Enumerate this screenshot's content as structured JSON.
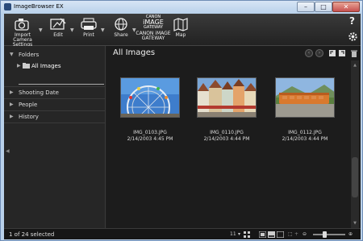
{
  "window": {
    "title": "ImageBrowser EX",
    "min_glyph": "–",
    "max_glyph": "□",
    "close_glyph": "✕"
  },
  "toolbar": {
    "import_label_1": "Import",
    "import_label_2": "Camera Settings",
    "edit_label": "Edit",
    "print_label": "Print",
    "share_label": "Share",
    "gateway_logo_1": "CANON",
    "gateway_logo_2": "iMAGE",
    "gateway_logo_3": "GATEWAY",
    "gateway_label_1": "CANON iMAGE",
    "gateway_label_2": "GATEWAY",
    "map_label": "Map",
    "help_glyph": "?"
  },
  "sidebar": {
    "folders_label": "Folders",
    "all_images_label": "All Images",
    "shooting_date_label": "Shooting Date",
    "people_label": "People",
    "history_label": "History"
  },
  "main": {
    "title": "All Images",
    "items": [
      {
        "filename": "IMG_0103.JPG",
        "date": "2/14/2003 4:45 PM"
      },
      {
        "filename": "IMG_0110.JPG",
        "date": "2/14/2003 4:44 PM"
      },
      {
        "filename": "IMG_0112.JPG",
        "date": "2/14/2003 4:44 PM"
      }
    ]
  },
  "status": {
    "selection_text": "1 of 24 selected",
    "view_size": "11",
    "zoom_fraction": 0.35
  },
  "colors": {
    "app_bg": "#1f1f1f",
    "panel_bg": "#262626",
    "titlebar": "#b9d1ea",
    "close_red": "#c75050"
  }
}
